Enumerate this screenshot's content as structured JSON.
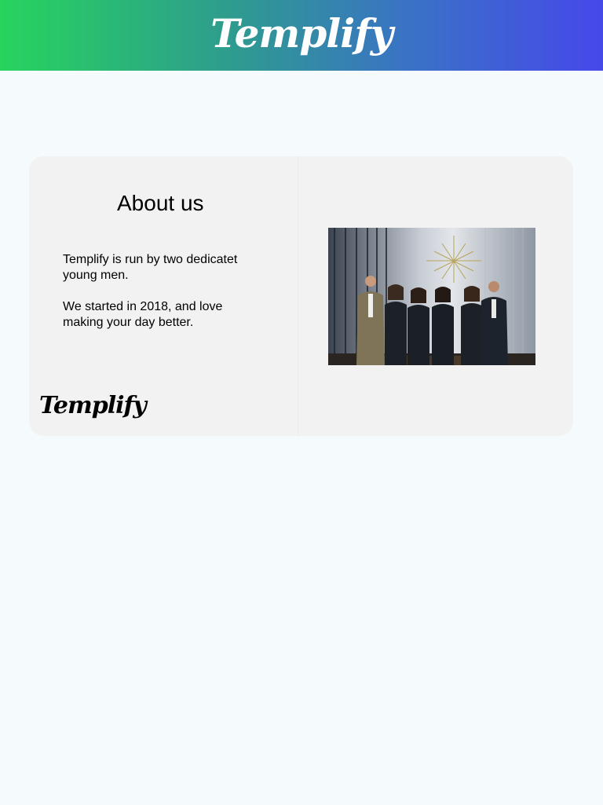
{
  "header": {
    "brand": "Templify"
  },
  "about": {
    "title": "About us",
    "paragraph_1": "Templify is run by two dedicatet young men.",
    "paragraph_2": "We started in 2018, and love making your day better.",
    "footer_brand": "Templify"
  },
  "colors": {
    "header_gradient_start": "#27d45e",
    "header_gradient_end": "#4648ea",
    "page_background": "#f5fbfd",
    "card_background": "#f2f2f2"
  }
}
